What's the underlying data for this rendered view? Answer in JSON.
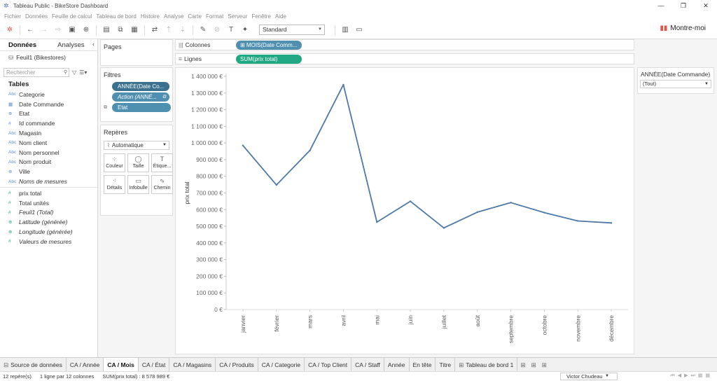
{
  "window": {
    "title": "Tableau Public - BikeStore Dashboard",
    "controls": [
      "—",
      "❐",
      "✕"
    ]
  },
  "menu": [
    "Fichier",
    "Données",
    "Feuille de calcul",
    "Tableau de bord",
    "Histoire",
    "Analyse",
    "Carte",
    "Format",
    "Serveur",
    "Fenêtre",
    "Aide"
  ],
  "toolbar": {
    "fit_select": "Standard",
    "show_me": "Montre-moi"
  },
  "data_pane": {
    "tabs": [
      "Données",
      "Analyses"
    ],
    "source": "Feuil1 (Bikestores)",
    "search_placeholder": "Rechercher",
    "tables_heading": "Tables",
    "dimensions": [
      {
        "type": "Abc",
        "name": "Categorie",
        "italic": false
      },
      {
        "type": "▦",
        "name": "Date Commande",
        "italic": false
      },
      {
        "type": "⊕",
        "name": "Etat",
        "italic": false
      },
      {
        "type": "#",
        "name": "Id commande",
        "italic": false
      },
      {
        "type": "Abc",
        "name": "Magasin",
        "italic": false
      },
      {
        "type": "Abc",
        "name": "Nom client",
        "italic": false
      },
      {
        "type": "Abc",
        "name": "Nom personnel",
        "italic": false
      },
      {
        "type": "Abc",
        "name": "Nom produit",
        "italic": false
      },
      {
        "type": "⊕",
        "name": "Ville",
        "italic": false
      },
      {
        "type": "Abc",
        "name": "Noms de mesures",
        "italic": true
      }
    ],
    "measures": [
      {
        "type": "#",
        "name": "prix total",
        "italic": false
      },
      {
        "type": "#",
        "name": "Total unités",
        "italic": false
      },
      {
        "type": "#",
        "name": "Feuil1 (Total)",
        "italic": true
      },
      {
        "type": "⊕",
        "name": "Latitude (générée)",
        "italic": true
      },
      {
        "type": "⊕",
        "name": "Longitude (générée)",
        "italic": true
      },
      {
        "type": "#",
        "name": "Valeurs de mesures",
        "italic": true
      }
    ]
  },
  "pages_card": {
    "title": "Pages"
  },
  "filters_card": {
    "title": "Filtres",
    "pills": [
      "ANNÉE(Date Co...",
      "Action (ANNÉ...",
      "Etat"
    ]
  },
  "marks_card": {
    "title": "Repères",
    "type_select": "Automatique",
    "buttons": [
      {
        "glyph": "⁘",
        "label": "Couleur"
      },
      {
        "glyph": "◯",
        "label": "Taille"
      },
      {
        "glyph": "T",
        "label": "Étique..."
      },
      {
        "glyph": "⁖",
        "label": "Détails"
      },
      {
        "glyph": "▭",
        "label": "Infobulle"
      },
      {
        "glyph": "∿",
        "label": "Chemin"
      }
    ]
  },
  "shelves": {
    "columns_label": "Colonnes",
    "columns_pill": "⊞ MOIS(Date Comm...",
    "rows_label": "Lignes",
    "rows_pill": "SUM(prix total)"
  },
  "right_filter": {
    "title": "ANNÉE(Date Commande)",
    "value": "(Tout)"
  },
  "chart_data": {
    "type": "line",
    "categories": [
      "janvier",
      "février",
      "mars",
      "avril",
      "mai",
      "juin",
      "juillet",
      "août",
      "septembre",
      "octobre",
      "novembre",
      "décembre"
    ],
    "series": [
      {
        "values": [
          985000,
          748000,
          955000,
          1350000,
          525000,
          650000,
          490000,
          585000,
          642000,
          582000,
          532000,
          520000
        ]
      }
    ],
    "ylabel": "prix total",
    "ylim": [
      0,
      1400000
    ],
    "yticks": [
      0,
      100000,
      200000,
      300000,
      400000,
      500000,
      600000,
      700000,
      800000,
      900000,
      1000000,
      1100000,
      1200000,
      1300000,
      1400000
    ],
    "ytick_labels": [
      "0 €",
      "100 000 €",
      "200 000 €",
      "300 000 €",
      "400 000 €",
      "500 000 €",
      "600 000 €",
      "700 000 €",
      "800 000 €",
      "900 000 €",
      "1 000 000 €",
      "1 100 000 €",
      "1 200 000 €",
      "1 300 000 €",
      "1 400 000 €"
    ],
    "line_color": "#4e79a7",
    "grid": false
  },
  "sheet_tabs": [
    {
      "label": "Source de données",
      "icon": "⊟",
      "active": false
    },
    {
      "label": "CA / Année",
      "icon": "",
      "active": false
    },
    {
      "label": "CA / Mois",
      "icon": "",
      "active": true
    },
    {
      "label": "CA / État",
      "icon": "",
      "active": false
    },
    {
      "label": "CA / Magasins",
      "icon": "",
      "active": false
    },
    {
      "label": "CA / Produits",
      "icon": "",
      "active": false
    },
    {
      "label": "CA / Categorie",
      "icon": "",
      "active": false
    },
    {
      "label": "CA / Top Client",
      "icon": "",
      "active": false
    },
    {
      "label": "CA / Staff",
      "icon": "",
      "active": false
    },
    {
      "label": "Année",
      "icon": "",
      "active": false
    },
    {
      "label": "En tête",
      "icon": "",
      "active": false
    },
    {
      "label": "Titre",
      "icon": "",
      "active": false
    },
    {
      "label": "Tableau de bord 1",
      "icon": "⊞",
      "active": false
    }
  ],
  "status_bar": {
    "marks": "12 repère(s)",
    "dims": "1 ligne par 12 colonnes",
    "sum": "SUM(prix total) : 8 578 989 €",
    "user": "Victor Chudeau"
  }
}
